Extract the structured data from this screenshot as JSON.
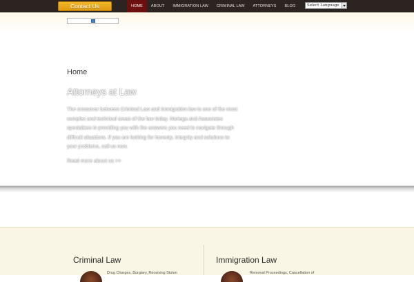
{
  "header": {
    "contact_label": "Contact Us",
    "nav": [
      {
        "label": "HOME",
        "active": true
      },
      {
        "label": "ABOUT",
        "active": false
      },
      {
        "label": "IMMIGRATION LAW",
        "active": false
      },
      {
        "label": "CRIMINAL LAW",
        "active": false
      },
      {
        "label": "ATTORNEYS",
        "active": false
      },
      {
        "label": "BLOG",
        "active": false
      }
    ],
    "language_select": "Select Language"
  },
  "hero": {
    "breadcrumb": "Home",
    "title": "Attorneys at Law",
    "text": "The crossover between Criminal Law and Immigration law is one of the most complex and technical areas of the law today.  Noriega and Associates specializes in providing you with the answers you need to navigate through difficult situations.  If you are looking for honesty, integrity and solutions to your problems, call us now.",
    "read_more": "Read more about us >>"
  },
  "practice_areas": [
    {
      "title": "Criminal Law",
      "snippet": "Drug Charges, Burglary, Receiving Stolen"
    },
    {
      "title": "Immigration Law",
      "snippet": "Removal Proceedings, Cancellation of"
    }
  ],
  "colors": {
    "topbar": "#2c2421",
    "nav_active": "#6b0f0f",
    "contact_button": "#e9a81c",
    "lower_bg": "#f9f6e5"
  }
}
